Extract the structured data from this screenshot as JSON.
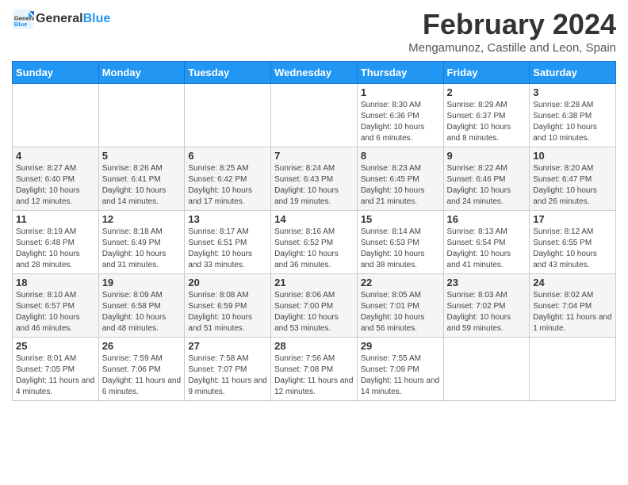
{
  "logo": {
    "line1": "General",
    "line2": "Blue"
  },
  "title": "February 2024",
  "subtitle": "Mengamunoz, Castille and Leon, Spain",
  "days_of_week": [
    "Sunday",
    "Monday",
    "Tuesday",
    "Wednesday",
    "Thursday",
    "Friday",
    "Saturday"
  ],
  "weeks": [
    [
      {
        "day": "",
        "info": ""
      },
      {
        "day": "",
        "info": ""
      },
      {
        "day": "",
        "info": ""
      },
      {
        "day": "",
        "info": ""
      },
      {
        "day": "1",
        "info": "Sunrise: 8:30 AM\nSunset: 6:36 PM\nDaylight: 10 hours and 6 minutes."
      },
      {
        "day": "2",
        "info": "Sunrise: 8:29 AM\nSunset: 6:37 PM\nDaylight: 10 hours and 8 minutes."
      },
      {
        "day": "3",
        "info": "Sunrise: 8:28 AM\nSunset: 6:38 PM\nDaylight: 10 hours and 10 minutes."
      }
    ],
    [
      {
        "day": "4",
        "info": "Sunrise: 8:27 AM\nSunset: 6:40 PM\nDaylight: 10 hours and 12 minutes."
      },
      {
        "day": "5",
        "info": "Sunrise: 8:26 AM\nSunset: 6:41 PM\nDaylight: 10 hours and 14 minutes."
      },
      {
        "day": "6",
        "info": "Sunrise: 8:25 AM\nSunset: 6:42 PM\nDaylight: 10 hours and 17 minutes."
      },
      {
        "day": "7",
        "info": "Sunrise: 8:24 AM\nSunset: 6:43 PM\nDaylight: 10 hours and 19 minutes."
      },
      {
        "day": "8",
        "info": "Sunrise: 8:23 AM\nSunset: 6:45 PM\nDaylight: 10 hours and 21 minutes."
      },
      {
        "day": "9",
        "info": "Sunrise: 8:22 AM\nSunset: 6:46 PM\nDaylight: 10 hours and 24 minutes."
      },
      {
        "day": "10",
        "info": "Sunrise: 8:20 AM\nSunset: 6:47 PM\nDaylight: 10 hours and 26 minutes."
      }
    ],
    [
      {
        "day": "11",
        "info": "Sunrise: 8:19 AM\nSunset: 6:48 PM\nDaylight: 10 hours and 28 minutes."
      },
      {
        "day": "12",
        "info": "Sunrise: 8:18 AM\nSunset: 6:49 PM\nDaylight: 10 hours and 31 minutes."
      },
      {
        "day": "13",
        "info": "Sunrise: 8:17 AM\nSunset: 6:51 PM\nDaylight: 10 hours and 33 minutes."
      },
      {
        "day": "14",
        "info": "Sunrise: 8:16 AM\nSunset: 6:52 PM\nDaylight: 10 hours and 36 minutes."
      },
      {
        "day": "15",
        "info": "Sunrise: 8:14 AM\nSunset: 6:53 PM\nDaylight: 10 hours and 38 minutes."
      },
      {
        "day": "16",
        "info": "Sunrise: 8:13 AM\nSunset: 6:54 PM\nDaylight: 10 hours and 41 minutes."
      },
      {
        "day": "17",
        "info": "Sunrise: 8:12 AM\nSunset: 6:55 PM\nDaylight: 10 hours and 43 minutes."
      }
    ],
    [
      {
        "day": "18",
        "info": "Sunrise: 8:10 AM\nSunset: 6:57 PM\nDaylight: 10 hours and 46 minutes."
      },
      {
        "day": "19",
        "info": "Sunrise: 8:09 AM\nSunset: 6:58 PM\nDaylight: 10 hours and 48 minutes."
      },
      {
        "day": "20",
        "info": "Sunrise: 8:08 AM\nSunset: 6:59 PM\nDaylight: 10 hours and 51 minutes."
      },
      {
        "day": "21",
        "info": "Sunrise: 8:06 AM\nSunset: 7:00 PM\nDaylight: 10 hours and 53 minutes."
      },
      {
        "day": "22",
        "info": "Sunrise: 8:05 AM\nSunset: 7:01 PM\nDaylight: 10 hours and 56 minutes."
      },
      {
        "day": "23",
        "info": "Sunrise: 8:03 AM\nSunset: 7:02 PM\nDaylight: 10 hours and 59 minutes."
      },
      {
        "day": "24",
        "info": "Sunrise: 8:02 AM\nSunset: 7:04 PM\nDaylight: 11 hours and 1 minute."
      }
    ],
    [
      {
        "day": "25",
        "info": "Sunrise: 8:01 AM\nSunset: 7:05 PM\nDaylight: 11 hours and 4 minutes."
      },
      {
        "day": "26",
        "info": "Sunrise: 7:59 AM\nSunset: 7:06 PM\nDaylight: 11 hours and 6 minutes."
      },
      {
        "day": "27",
        "info": "Sunrise: 7:58 AM\nSunset: 7:07 PM\nDaylight: 11 hours and 9 minutes."
      },
      {
        "day": "28",
        "info": "Sunrise: 7:56 AM\nSunset: 7:08 PM\nDaylight: 11 hours and 12 minutes."
      },
      {
        "day": "29",
        "info": "Sunrise: 7:55 AM\nSunset: 7:09 PM\nDaylight: 11 hours and 14 minutes."
      },
      {
        "day": "",
        "info": ""
      },
      {
        "day": "",
        "info": ""
      }
    ]
  ]
}
